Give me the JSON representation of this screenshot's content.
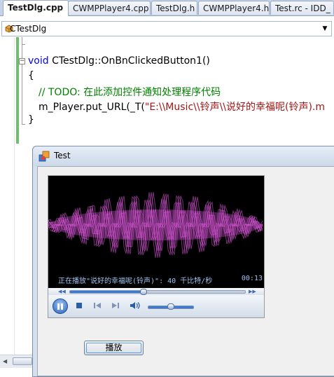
{
  "tabs": [
    {
      "label": "TestDlg.cpp",
      "active": true
    },
    {
      "label": "CWMPPlayer4.cpp",
      "active": false
    },
    {
      "label": "TestDlg.h",
      "active": false
    },
    {
      "label": "CWMPPlayer4.h",
      "active": false
    },
    {
      "label": "Test.rc - IDD_",
      "active": false
    }
  ],
  "class_combo": {
    "value": "CTestDlg"
  },
  "code": {
    "func_keyword": "void",
    "func_signature": " CTestDlg::OnBnClickedButton1()",
    "open_brace": "{",
    "comment": "// TODO: 在此添加控件通知处理程序代码",
    "call_prefix": "m_Player.put_URL(_T(",
    "call_string": "\"E:\\\\Music\\\\铃声\\\\说好的幸福呢(铃声).m",
    "close_brace": "}"
  },
  "dialog": {
    "title": "Test",
    "play_button_label": "播放"
  },
  "player": {
    "status_text": "正在播放\"说好的幸福呢(铃声)\": 40 千比特/秒",
    "elapsed_time": "00:13",
    "seek_progress": 0.42,
    "volume_level": 0.5,
    "state": "playing"
  },
  "colors": {
    "keyword": "#0000ff",
    "comment": "#008000",
    "string": "#a31515",
    "visualization": "#e05ae0",
    "accent": "#3b7bd4"
  }
}
